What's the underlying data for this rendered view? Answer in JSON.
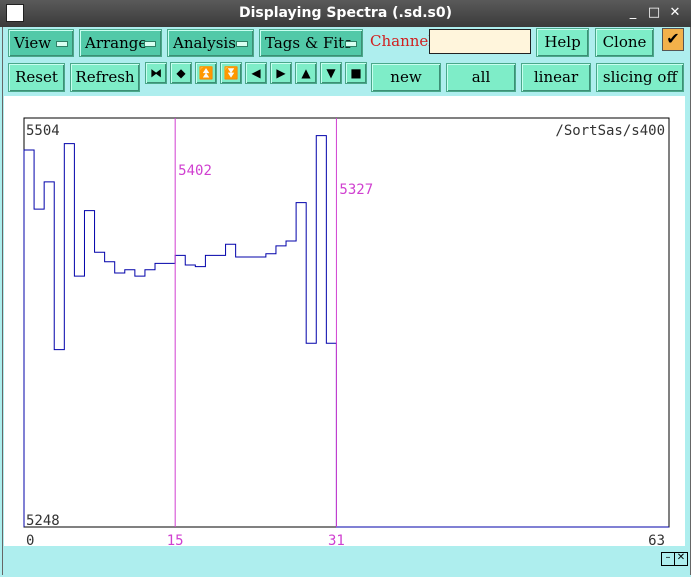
{
  "window": {
    "title": "Displaying Spectra (.sd.s0)",
    "minimize_glyph": "_",
    "maximize_glyph": "□",
    "close_glyph": "✕"
  },
  "toolbar_row1": {
    "view": "View",
    "arrange": "Arrange",
    "analysis": "Analysis",
    "tags_fits": "Tags & Fits",
    "channel_label": "Channel:",
    "channel_value": "",
    "help": "Help",
    "clone": "Clone",
    "check_glyph": "✔"
  },
  "toolbar_row2": {
    "reset": "Reset",
    "refresh": "Refresh",
    "nav_icons": [
      "⧓",
      "◆",
      "⏫",
      "⏬",
      "◀",
      "▶",
      "▲",
      "▼",
      "■"
    ],
    "new": "new",
    "all": "all",
    "linear": "linear",
    "slicing": "slicing off"
  },
  "colors": {
    "accent": "#7eedc8",
    "menu": "#52c9a8",
    "trace": "#0000aa",
    "marker": "#d040d0",
    "background": "#aeeeee"
  },
  "chart_data": {
    "type": "line",
    "title": "/SortSas/s400",
    "ymax_label": "5504",
    "ymin_label": "5248",
    "ylim": [
      5248,
      5504
    ],
    "xlim": [
      0,
      63
    ],
    "x_ticks": [
      "0",
      "15",
      "31",
      "63"
    ],
    "markers": [
      {
        "channel": 15,
        "label": "5402"
      },
      {
        "channel": 31,
        "label": "5327"
      }
    ],
    "x": [
      0,
      1,
      2,
      3,
      4,
      5,
      6,
      7,
      8,
      9,
      10,
      11,
      12,
      13,
      14,
      15,
      16,
      17,
      18,
      19,
      20,
      21,
      22,
      23,
      24,
      25,
      26,
      27,
      28,
      29,
      30,
      31,
      32,
      33,
      34,
      35,
      36,
      37,
      38,
      39,
      40,
      41,
      42,
      43,
      44,
      45,
      46,
      47,
      48,
      49,
      50,
      51,
      52,
      53,
      54,
      55,
      56,
      57,
      58,
      59,
      60,
      61,
      62,
      63
    ],
    "values": [
      5484,
      5447,
      5464,
      5359,
      5488,
      5405,
      5446,
      5420,
      5414,
      5407,
      5409,
      5405,
      5409,
      5413,
      5413,
      5418,
      5412,
      5411,
      5418,
      5418,
      5425,
      5417,
      5417,
      5417,
      5419,
      5424,
      5427,
      5451,
      5363,
      5493,
      5363,
      5248,
      5248,
      5248,
      5248,
      5248,
      5248,
      5248,
      5248,
      5248,
      5248,
      5248,
      5248,
      5248,
      5248,
      5248,
      5248,
      5248,
      5248,
      5248,
      5248,
      5248,
      5248,
      5248,
      5248,
      5248,
      5248,
      5248,
      5248,
      5248,
      5248,
      5248,
      5248,
      5248
    ]
  }
}
